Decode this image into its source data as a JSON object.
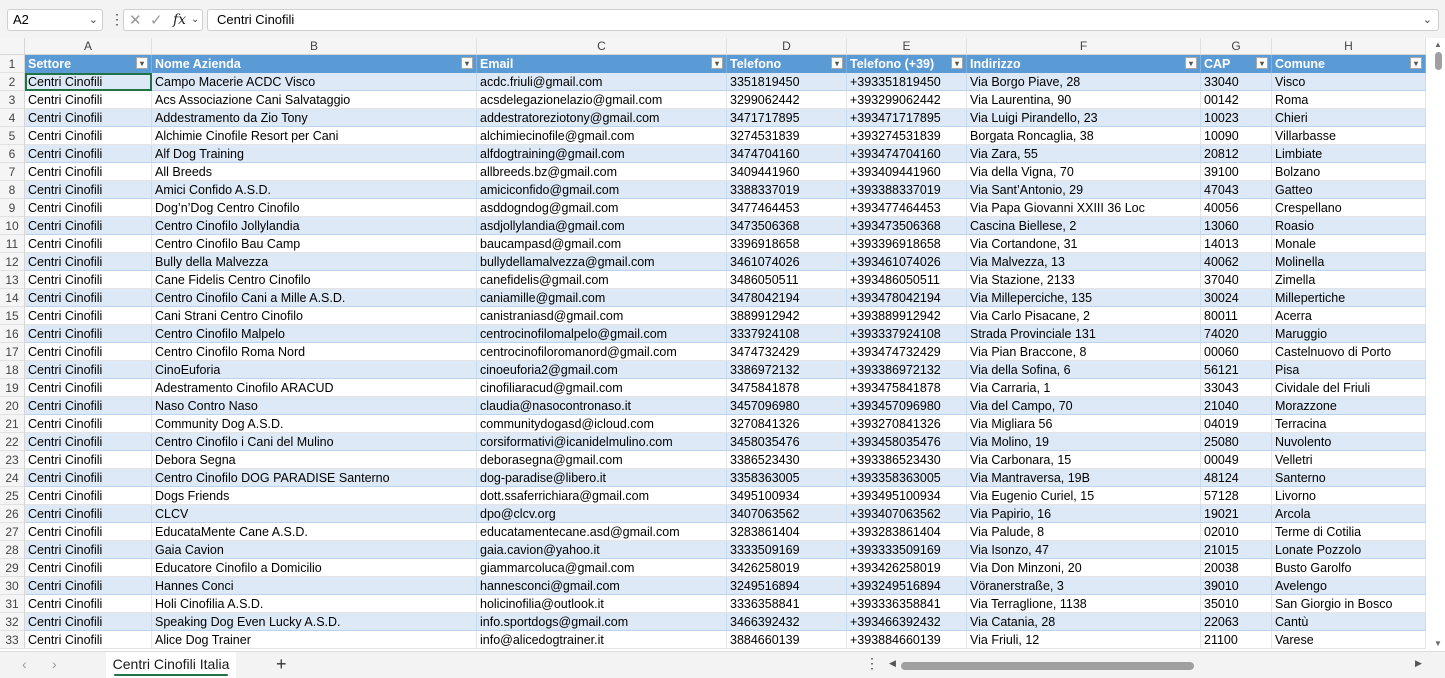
{
  "formula_bar": {
    "name_box": "A2",
    "formula": "Centri Cinofili"
  },
  "columns": [
    {
      "letter": "A",
      "header": "Settore"
    },
    {
      "letter": "B",
      "header": "Nome Azienda"
    },
    {
      "letter": "C",
      "header": "Email"
    },
    {
      "letter": "D",
      "header": "Telefono"
    },
    {
      "letter": "E",
      "header": "Telefono (+39)"
    },
    {
      "letter": "F",
      "header": "Indirizzo"
    },
    {
      "letter": "G",
      "header": "CAP"
    },
    {
      "letter": "H",
      "header": "Comune"
    }
  ],
  "header_row_number": "1",
  "rows": [
    {
      "n": "2",
      "cells": [
        "Centri Cinofili",
        "Campo Macerie ACDC Visco",
        "acdc.friuli@gmail.com",
        "3351819450",
        "+393351819450",
        "Via Borgo Piave, 28",
        "33040",
        "Visco"
      ]
    },
    {
      "n": "3",
      "cells": [
        "Centri Cinofili",
        "Acs Associazione Cani Salvataggio",
        "acsdelegazionelazio@gmail.com",
        "3299062442",
        "+393299062442",
        "Via Laurentina, 90",
        "00142",
        "Roma"
      ]
    },
    {
      "n": "4",
      "cells": [
        "Centri Cinofili",
        "Addestramento da Zio Tony",
        "addestratoreziotony@gmail.com",
        "3471717895",
        "+393471717895",
        "Via Luigi Pirandello, 23",
        "10023",
        "Chieri"
      ]
    },
    {
      "n": "5",
      "cells": [
        "Centri Cinofili",
        "Alchimie Cinofile Resort per Cani",
        "alchimiecinofile@gmail.com",
        "3274531839",
        "+393274531839",
        "Borgata Roncaglia, 38",
        "10090",
        "Villarbasse"
      ]
    },
    {
      "n": "6",
      "cells": [
        "Centri Cinofili",
        "Alf Dog Training",
        "alfdogtraining@gmail.com",
        "3474704160",
        "+393474704160",
        "Via Zara, 55",
        "20812",
        "Limbiate"
      ]
    },
    {
      "n": "7",
      "cells": [
        "Centri Cinofili",
        "All Breeds",
        "allbreeds.bz@gmail.com",
        "3409441960",
        "+393409441960",
        "Via della Vigna, 70",
        "39100",
        "Bolzano"
      ]
    },
    {
      "n": "8",
      "cells": [
        "Centri Cinofili",
        "Amici Confido A.S.D.",
        "amiciconfido@gmail.com",
        "3388337019",
        "+393388337019",
        "Via Sant’Antonio, 29",
        "47043",
        "Gatteo"
      ]
    },
    {
      "n": "9",
      "cells": [
        "Centri Cinofili",
        "Dog’n’Dog Centro Cinofilo",
        "asddogndog@gmail.com",
        "3477464453",
        "+393477464453",
        "Via Papa Giovanni XXIII 36 Loc",
        "40056",
        "Crespellano"
      ]
    },
    {
      "n": "10",
      "cells": [
        "Centri Cinofili",
        "Centro Cinofilo Jollylandia",
        "asdjollylandia@gmail.com",
        "3473506368",
        "+393473506368",
        "Cascina Biellese, 2",
        "13060",
        "Roasio"
      ]
    },
    {
      "n": "11",
      "cells": [
        "Centri Cinofili",
        "Centro Cinofilo Bau Camp",
        "baucampasd@gmail.com",
        "3396918658",
        "+393396918658",
        "Via Cortandone, 31",
        "14013",
        "Monale"
      ]
    },
    {
      "n": "12",
      "cells": [
        "Centri Cinofili",
        "Bully della Malvezza",
        "bullydellamalvezza@gmail.com",
        "3461074026",
        "+393461074026",
        "Via Malvezza, 13",
        "40062",
        "Molinella"
      ]
    },
    {
      "n": "13",
      "cells": [
        "Centri Cinofili",
        "Cane Fidelis Centro Cinofilo",
        "canefidelis@gmail.com",
        "3486050511",
        "+393486050511",
        "Via Stazione, 2133",
        "37040",
        "Zimella"
      ]
    },
    {
      "n": "14",
      "cells": [
        "Centri Cinofili",
        "Centro Cinofilo Cani a Mille A.S.D.",
        "caniamille@gmail.com",
        "3478042194",
        "+393478042194",
        "Via Milleperciche, 135",
        "30024",
        "Millepertiche"
      ]
    },
    {
      "n": "15",
      "cells": [
        "Centri Cinofili",
        "Cani Strani Centro Cinofilo",
        "canistraniasd@gmail.com",
        "3889912942",
        "+393889912942",
        "Via Carlo Pisacane, 2",
        "80011",
        "Acerra"
      ]
    },
    {
      "n": "16",
      "cells": [
        "Centri Cinofili",
        "Centro Cinofilo Malpelo",
        "centrocinofilomalpelo@gmail.com",
        "3337924108",
        "+393337924108",
        "Strada Provinciale 131",
        "74020",
        "Maruggio"
      ]
    },
    {
      "n": "17",
      "cells": [
        "Centri Cinofili",
        "Centro Cinofilo Roma Nord",
        "centrocinofiloromanord@gmail.com",
        "3474732429",
        "+393474732429",
        "Via Pian Braccone, 8",
        "00060",
        "Castelnuovo di Porto"
      ]
    },
    {
      "n": "18",
      "cells": [
        "Centri Cinofili",
        "CinoEuforia",
        "cinoeuforia2@gmail.com",
        "3386972132",
        "+393386972132",
        "Via della Sofina, 6",
        "56121",
        "Pisa"
      ]
    },
    {
      "n": "19",
      "cells": [
        "Centri Cinofili",
        "Adestramento Cinofilo ARACUD",
        "cinofiliaracud@gmail.com",
        "3475841878",
        "+393475841878",
        "Via Carraria, 1",
        "33043",
        "Cividale del Friuli"
      ]
    },
    {
      "n": "20",
      "cells": [
        "Centri Cinofili",
        "Naso Contro Naso",
        "claudia@nasocontronaso.it",
        "3457096980",
        "+393457096980",
        "Via del Campo, 70",
        "21040",
        "Morazzone"
      ]
    },
    {
      "n": "21",
      "cells": [
        "Centri Cinofili",
        "Community Dog A.S.D.",
        "communitydogasd@icloud.com",
        "3270841326",
        "+393270841326",
        "Via Migliara 56",
        "04019",
        "Terracina"
      ]
    },
    {
      "n": "22",
      "cells": [
        "Centri Cinofili",
        "Centro Cinofilo i Cani del Mulino",
        "corsiformativi@icanidelmulino.com",
        "3458035476",
        "+393458035476",
        "Via Molino, 19",
        "25080",
        "Nuvolento"
      ]
    },
    {
      "n": "23",
      "cells": [
        "Centri Cinofili",
        "Debora Segna",
        "deborasegna@gmail.com",
        "3386523430",
        "+393386523430",
        "Via Carbonara, 15",
        "00049",
        "Velletri"
      ]
    },
    {
      "n": "24",
      "cells": [
        "Centri Cinofili",
        "Centro Cinofilo DOG PARADISE Santerno",
        "dog-paradise@libero.it",
        "3358363005",
        "+393358363005",
        "Via Mantraversa, 19B",
        "48124",
        "Santerno"
      ]
    },
    {
      "n": "25",
      "cells": [
        "Centri Cinofili",
        "Dogs Friends",
        "dott.ssaferrichiara@gmail.com",
        "3495100934",
        "+393495100934",
        "Via Eugenio Curiel, 15",
        "57128",
        "Livorno"
      ]
    },
    {
      "n": "26",
      "cells": [
        "Centri Cinofili",
        "CLCV",
        "dpo@clcv.org",
        "3407063562",
        "+393407063562",
        "Via Papirio, 16",
        "19021",
        "Arcola"
      ]
    },
    {
      "n": "27",
      "cells": [
        "Centri Cinofili",
        "EducataMente Cane A.S.D.",
        "educatamentecane.asd@gmail.com",
        "3283861404",
        "+393283861404",
        "Via Palude, 8",
        "02010",
        "Terme di Cotilia"
      ]
    },
    {
      "n": "28",
      "cells": [
        "Centri Cinofili",
        "Gaia Cavion",
        "gaia.cavion@yahoo.it",
        "3333509169",
        "+393333509169",
        "Via Isonzo, 47",
        "21015",
        "Lonate Pozzolo"
      ]
    },
    {
      "n": "29",
      "cells": [
        "Centri Cinofili",
        "Educatore Cinofilo a Domicilio",
        "giammarcoluca@gmail.com",
        "3426258019",
        "+393426258019",
        "Via Don Minzoni, 20",
        "20038",
        "Busto Garolfo"
      ]
    },
    {
      "n": "30",
      "cells": [
        "Centri Cinofili",
        "Hannes Conci",
        "hannesconci@gmail.com",
        "3249516894",
        "+393249516894",
        "Vöranerstraße, 3",
        "39010",
        "Avelengo"
      ]
    },
    {
      "n": "31",
      "cells": [
        "Centri Cinofili",
        "Holi Cinofilia A.S.D.",
        "holicinofilia@outlook.it",
        "3336358841",
        "+393336358841",
        "Via Terraglione, 1138",
        "35010",
        "San Giorgio in Bosco"
      ]
    },
    {
      "n": "32",
      "cells": [
        "Centri Cinofili",
        "Speaking Dog Even Lucky A.S.D.",
        "info.sportdogs@gmail.com",
        "3466392432",
        "+393466392432",
        "Via Catania, 28",
        "22063",
        "Cantù"
      ]
    },
    {
      "n": "33",
      "cells": [
        "Centri Cinofili",
        "Alice Dog Trainer",
        "info@alicedogtrainer.it",
        "3884660139",
        "+393884660139",
        "Via Friuli, 12",
        "21100",
        "Varese"
      ]
    }
  ],
  "sheet_tab": "Centri Cinofili Italia",
  "colors": {
    "header_fill": "#5b9bd5",
    "band_fill": "#dde9f6",
    "selection": "#217346"
  }
}
